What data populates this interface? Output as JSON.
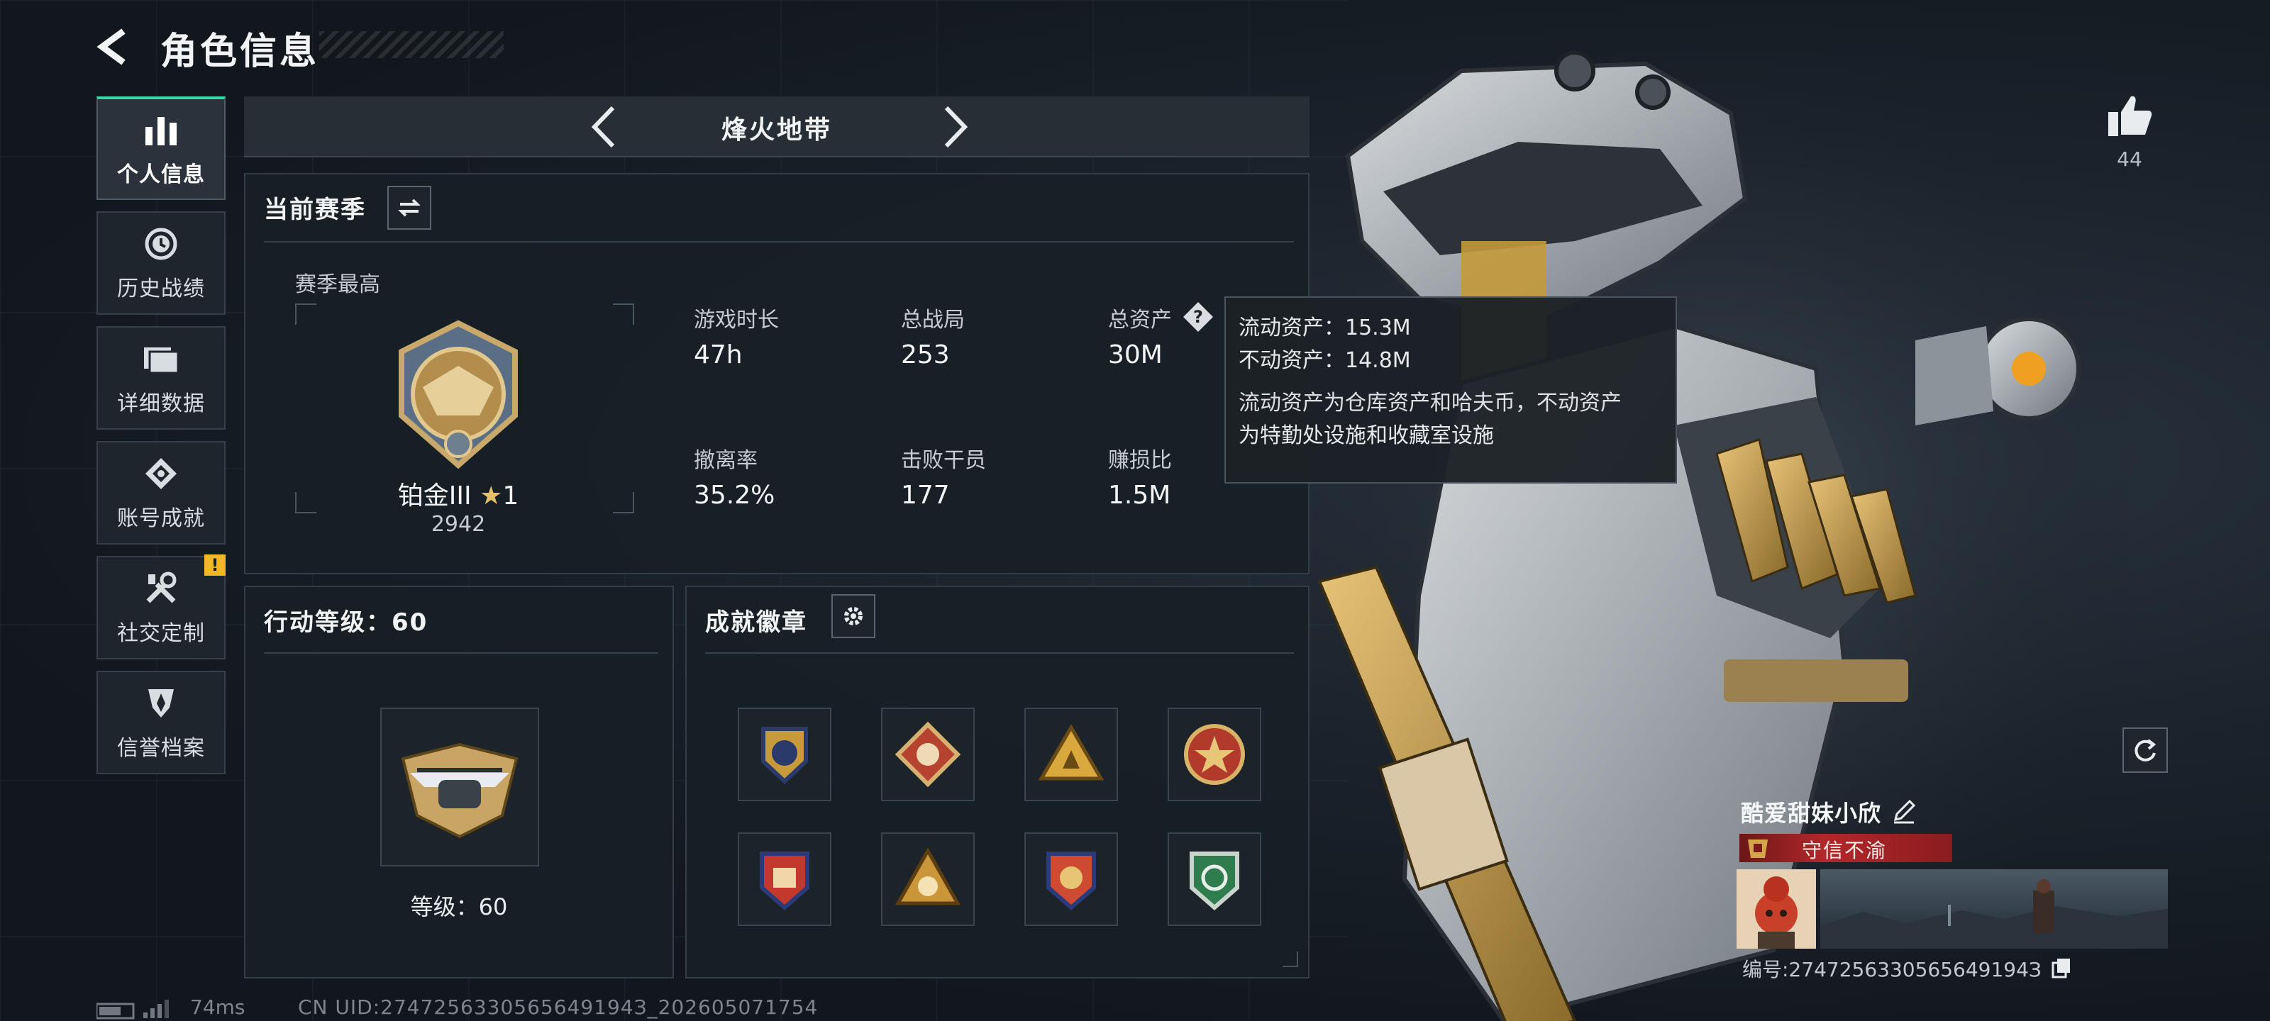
{
  "header": {
    "title": "角色信息"
  },
  "sidebar": {
    "items": [
      {
        "label": "个人信息",
        "icon": "bar-chart-icon",
        "active": true
      },
      {
        "label": "历史战绩",
        "icon": "history-clock-icon"
      },
      {
        "label": "详细数据",
        "icon": "folders-icon"
      },
      {
        "label": "账号成就",
        "icon": "achievement-diamond-icon"
      },
      {
        "label": "社交定制",
        "icon": "tools-icon",
        "badge": "!"
      },
      {
        "label": "信誉档案",
        "icon": "shield-emblem-icon"
      }
    ]
  },
  "mode": {
    "title": "烽火地带"
  },
  "season": {
    "header": "当前赛季",
    "best_label": "赛季最高",
    "rank_name": "铂金III",
    "rank_stars": "1",
    "rank_score": "2942",
    "stats": [
      {
        "label": "游戏时长",
        "value": "47h"
      },
      {
        "label": "总战局",
        "value": "253"
      },
      {
        "label": "总资产",
        "value": "30M"
      },
      {
        "label": "撤离率",
        "value": "35.2%"
      },
      {
        "label": "击败干员",
        "value": "177"
      },
      {
        "label": "赚损比",
        "value": "1.5M"
      }
    ]
  },
  "tooltip": {
    "line1": "流动资产：15.3M",
    "line2": "不动资产：14.8M",
    "desc1": "流动资产为仓库资产和哈夫币，不动资产",
    "desc2": "为特勤处设施和收藏室设施"
  },
  "action_level": {
    "header": "行动等级：60",
    "level_label": "等级：60"
  },
  "achievements": {
    "header": "成就徽章",
    "badges": [
      "badge-1",
      "badge-2",
      "badge-3",
      "badge-4",
      "badge-5",
      "badge-6",
      "badge-7",
      "badge-8"
    ]
  },
  "likes": {
    "count": "44"
  },
  "player": {
    "name": "酷爱甜妹小欣",
    "title_tag": "守信不渝",
    "id_line": "编号:2747256330565649194З"
  },
  "footer": {
    "ping": "74ms",
    "uid": "CN UID:2747256330565649194З_202605071754"
  },
  "colors": {
    "accent": "#39d9a4",
    "warn": "#f0b826",
    "tag_red": "#b3272b"
  }
}
